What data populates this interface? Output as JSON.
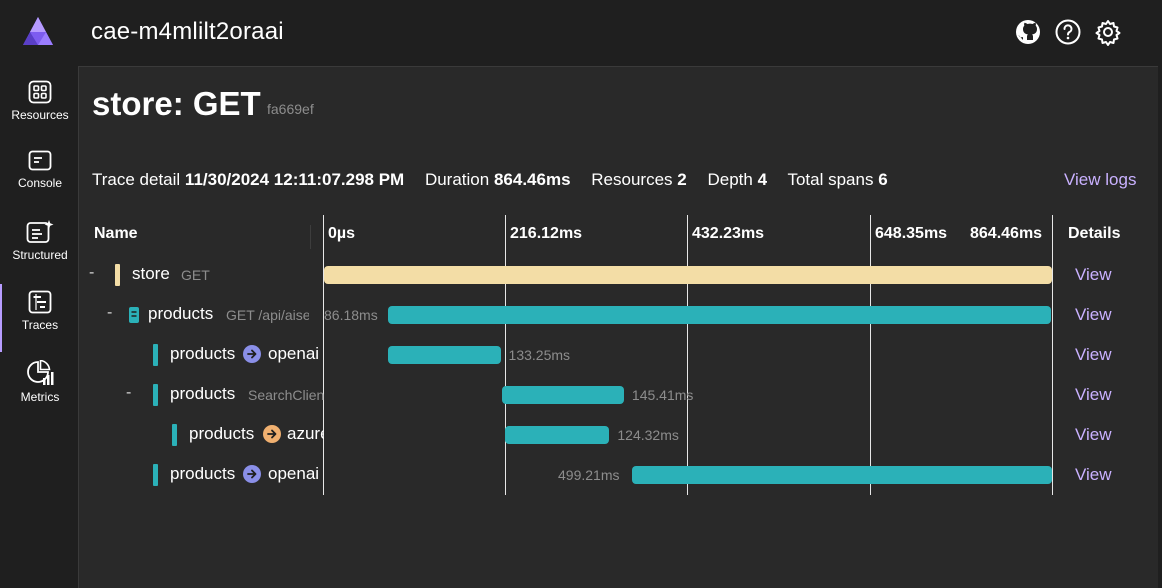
{
  "app": {
    "title": "cae-m4mlilt2oraai",
    "logo": "aspire-logo"
  },
  "top_icons": [
    "github-icon",
    "help-icon",
    "settings-icon"
  ],
  "sidebar": {
    "items": [
      {
        "label": "Resources",
        "icon": "resources-icon",
        "active": false
      },
      {
        "label": "Console",
        "icon": "console-icon",
        "active": false
      },
      {
        "label": "Structured",
        "icon": "structured-icon",
        "active": false
      },
      {
        "label": "Traces",
        "icon": "traces-icon",
        "active": true
      },
      {
        "label": "Metrics",
        "icon": "metrics-icon",
        "active": false
      }
    ]
  },
  "page": {
    "title": "store: GET",
    "trace_id": "fa669ef"
  },
  "summary": {
    "trace_detail_label": "Trace detail",
    "trace_detail_value": "11/30/2024 12:11:07.298 PM",
    "duration_label": "Duration",
    "duration_value": "864.46ms",
    "resources_label": "Resources",
    "resources_value": "2",
    "depth_label": "Depth",
    "depth_value": "4",
    "total_spans_label": "Total spans",
    "total_spans_value": "6",
    "view_logs": "View logs"
  },
  "grid": {
    "name_header": "Name",
    "details_header": "Details",
    "ticks": [
      "0µs",
      "216.12ms",
      "432.23ms",
      "648.35ms",
      "864.46ms"
    ]
  },
  "colors": {
    "store": "#f3dda6",
    "products": "#2bb1b8",
    "internal_dot": "#8a8fe8",
    "external_dot": "#f0b070",
    "link": "#c9b1ff"
  },
  "spans": [
    {
      "collapse": "-",
      "service": "store",
      "sub": "GET",
      "target": "",
      "dot": "",
      "bar_label": "",
      "start_fraction": 0.0,
      "end_fraction": 1.0,
      "view": "View"
    },
    {
      "collapse": "-",
      "service": "products",
      "sub": "GET /api/aisearch",
      "target": "",
      "dot": "",
      "bar_label": "86.18ms",
      "start_fraction": 0.0875,
      "end_fraction": 0.998,
      "view": "View"
    },
    {
      "collapse": "",
      "service": "products",
      "sub": "",
      "target": "openai",
      "dot": "internal",
      "bar_label": "133.25ms",
      "start_fraction": 0.0885,
      "end_fraction": 0.2425,
      "view": "View"
    },
    {
      "collapse": "-",
      "service": "products",
      "sub": "SearchClient",
      "target": "",
      "dot": "",
      "bar_label": "145.41ms",
      "start_fraction": 0.244,
      "end_fraction": 0.412,
      "view": "View"
    },
    {
      "collapse": "",
      "service": "products",
      "sub": "",
      "target": "azure",
      "dot": "external",
      "bar_label": "124.32ms",
      "start_fraction": 0.248,
      "end_fraction": 0.392,
      "view": "View"
    },
    {
      "collapse": "",
      "service": "products",
      "sub": "",
      "target": "openai",
      "dot": "internal",
      "bar_label": "499.21ms",
      "start_fraction": 0.4225,
      "end_fraction": 0.9995,
      "view": "View"
    }
  ]
}
